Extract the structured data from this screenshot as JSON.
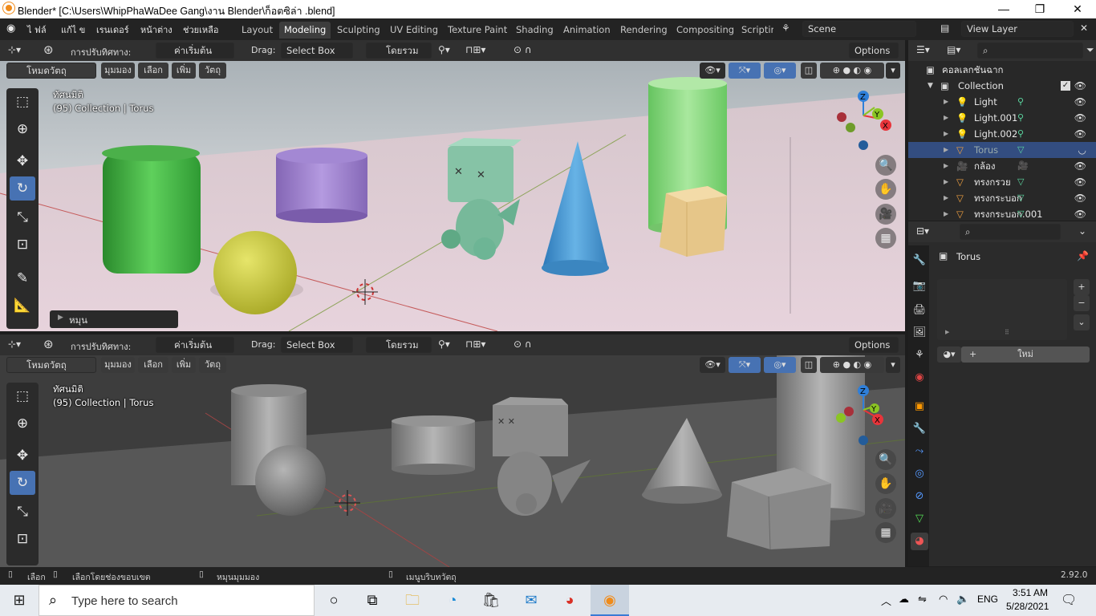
{
  "window": {
    "title": "Blender* [C:\\Users\\WhipPhaWaDee Gang\\งาน Blender\\ก็อตซิล่า .blend]",
    "minimize": "—",
    "maximize": "❐",
    "close": "✕"
  },
  "menus": [
    "ไ ฟล์",
    "แก้ไ ข",
    "เรนเดอร์",
    "หน้าต่าง",
    "ช่วยเหลือ"
  ],
  "workspaces": [
    "Layout",
    "Modeling",
    "Sculpting",
    "UV Editing",
    "Texture Paint",
    "Shading",
    "Animation",
    "Rendering",
    "Compositing",
    "Scriptin"
  ],
  "active_workspace": "Modeling",
  "scene": "Scene",
  "view_layer": "View Layer",
  "viewport_header": {
    "orientation_label": "การปรับทิศทาง:",
    "orientation_value": "ค่าเริ่มต้น",
    "drag_label": "Drag:",
    "drag_value": "Select Box",
    "pivot": "โดยรวม",
    "options": "Options"
  },
  "viewport_subheader": {
    "mode": "โหมดวัตถุ",
    "items": [
      "มุมมอง",
      "เลือก",
      "เพิ่ม",
      "วัตถุ"
    ]
  },
  "viewport_top": {
    "view_name": "ทัศนมิติ",
    "collection_info": "(95) Collection | Torus",
    "last_op": "หมุน"
  },
  "viewport_bottom": {
    "view_name": "ทัศนมิติ",
    "collection_info": "(95) Collection | Torus"
  },
  "gizmo": {
    "x": "X",
    "y": "Y",
    "z": "Z"
  },
  "outliner": {
    "root": "คอลเลกชันฉาก",
    "collection": "Collection",
    "items": [
      {
        "name": "Light",
        "icon": "light-icon",
        "selected": false
      },
      {
        "name": "Light.001",
        "icon": "light-icon",
        "selected": false
      },
      {
        "name": "Light.002",
        "icon": "light-icon",
        "selected": false
      },
      {
        "name": "Torus",
        "icon": "mesh-icon",
        "selected": true
      },
      {
        "name": "กล้อง",
        "icon": "camera-icon",
        "selected": false
      },
      {
        "name": "ทรงกรวย",
        "icon": "mesh-icon",
        "selected": false
      },
      {
        "name": "ทรงกระบอก",
        "icon": "mesh-icon",
        "selected": false
      },
      {
        "name": "ทรงกระบอก.001",
        "icon": "mesh-icon",
        "selected": false
      }
    ]
  },
  "properties": {
    "object_name": "Torus",
    "new_button": "ใหม่"
  },
  "statusbar": {
    "select": "เลือก",
    "box_select": "เลือกโดยช่องขอบเขต",
    "rotate_view": "หมุนมุมมอง",
    "context_menu": "เมนูบริบทวัตถุ",
    "version": "2.92.0"
  },
  "taskbar": {
    "search_placeholder": "Type here to search",
    "lang": "ENG",
    "time": "3:51 AM",
    "date": "5/28/2021"
  },
  "colors": {
    "accent": "#4772b3",
    "selected_row": "#334d80",
    "x_axis": "#e8343a",
    "y_axis": "#8bc523",
    "z_axis": "#2f7fd9"
  }
}
